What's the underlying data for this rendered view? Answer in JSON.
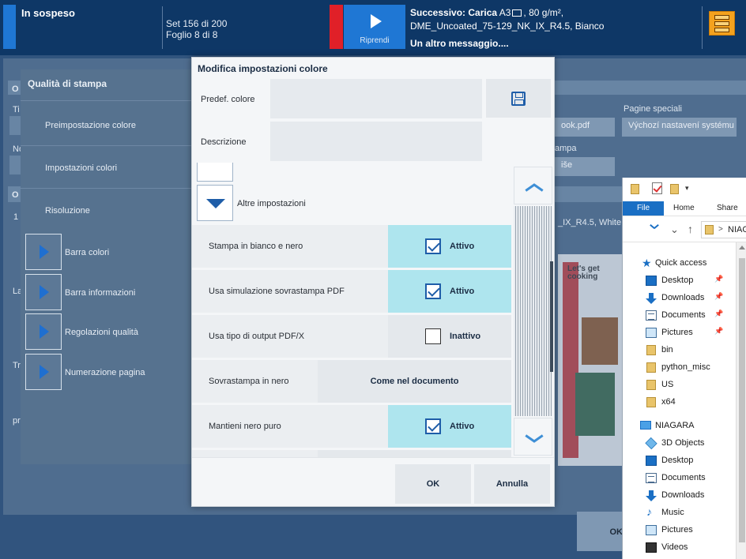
{
  "topbar": {
    "state": "In sospeso",
    "count_line1": "Set 156 di 200",
    "count_line2": "Foglio 8 di 8",
    "resume_label": "Riprendi",
    "next_prefix": "Successivo: Carica",
    "next_size": "A3",
    "next_weight": ", 80 g/m²,",
    "next_media": "DME_Uncoated_75-129_NK_IX_R4.5, Bianco",
    "message": "Un altro messaggio...."
  },
  "background": {
    "panel_title": "Qualità di stampa",
    "items": [
      "Preimpostazione colore",
      "Impostazioni colori",
      "Risoluzione"
    ],
    "expanders": [
      "Barra colori",
      "Barra informazioni",
      "Regolazioni qualità",
      "Numerazione pagina"
    ],
    "tab_o1": "O",
    "tab_o2": "O",
    "label_ti": "Ti",
    "label_no": "No",
    "label_1": "1",
    "label_la": "La",
    "label_tr": "Tr",
    "label_pr": "pr",
    "special_pages_label": "Pagine speciali",
    "special_pages_value": "Výchozí nastavení systému",
    "file_fragment": "ook.pdf",
    "stampa_fragment": "ampa",
    "ise_fragment": "iše",
    "media_fragment": "_IX_R4.5, White |",
    "thumb_text": "Let's get cooking",
    "ok_label": "OK"
  },
  "dialog": {
    "title": "Modifica impostazioni colore",
    "preset_label": "Predef. colore",
    "preset_value": "",
    "description_label": "Descrizione",
    "description_value": "",
    "section_label": "Altre impostazioni",
    "rows": [
      {
        "label": "Stampa in bianco e nero",
        "state": "Attivo"
      },
      {
        "label": "Usa simulazione sovrastampa PDF",
        "state": "Attivo"
      },
      {
        "label": "Usa tipo di output PDF/X",
        "state": "Inattivo"
      },
      {
        "label": "Sovrastampa in nero",
        "state": "Come nel documento"
      },
      {
        "label": "Mantieni nero puro",
        "state": "Attivo"
      }
    ],
    "ok_label": "OK",
    "cancel_label": "Annulla"
  },
  "explorer": {
    "tabs": {
      "file": "File",
      "home": "Home",
      "share": "Share"
    },
    "path_text": "NIAG",
    "path_sep": ">",
    "tree": [
      {
        "name": "Quick access",
        "icon": "star-icon",
        "pinned": false
      },
      {
        "name": "Desktop",
        "icon": "desktop-icon",
        "pinned": true
      },
      {
        "name": "Downloads",
        "icon": "download-icon",
        "pinned": true
      },
      {
        "name": "Documents",
        "icon": "document-icon",
        "pinned": true
      },
      {
        "name": "Pictures",
        "icon": "pictures-icon",
        "pinned": true
      },
      {
        "name": "bin",
        "icon": "folder-icon",
        "pinned": false
      },
      {
        "name": "python_misc",
        "icon": "folder-icon",
        "pinned": false
      },
      {
        "name": "US",
        "icon": "folder-icon",
        "pinned": false
      },
      {
        "name": "x64",
        "icon": "folder-icon",
        "pinned": false
      },
      {
        "name": "NIAGARA",
        "icon": "computer-icon",
        "pinned": false
      },
      {
        "name": "3D Objects",
        "icon": "3d-objects-icon",
        "pinned": false
      },
      {
        "name": "Desktop",
        "icon": "desktop-icon",
        "pinned": false
      },
      {
        "name": "Documents",
        "icon": "document-icon",
        "pinned": false
      },
      {
        "name": "Downloads",
        "icon": "download-icon",
        "pinned": false
      },
      {
        "name": "Music",
        "icon": "music-icon",
        "pinned": false
      },
      {
        "name": "Pictures",
        "icon": "pictures-icon",
        "pinned": false
      },
      {
        "name": "Videos",
        "icon": "videos-icon",
        "pinned": false
      }
    ]
  },
  "colors": {
    "accent": "#1f77d4",
    "alert": "#e02028",
    "active_toggle": "#aee5ee",
    "menu": "#f4a21e"
  }
}
